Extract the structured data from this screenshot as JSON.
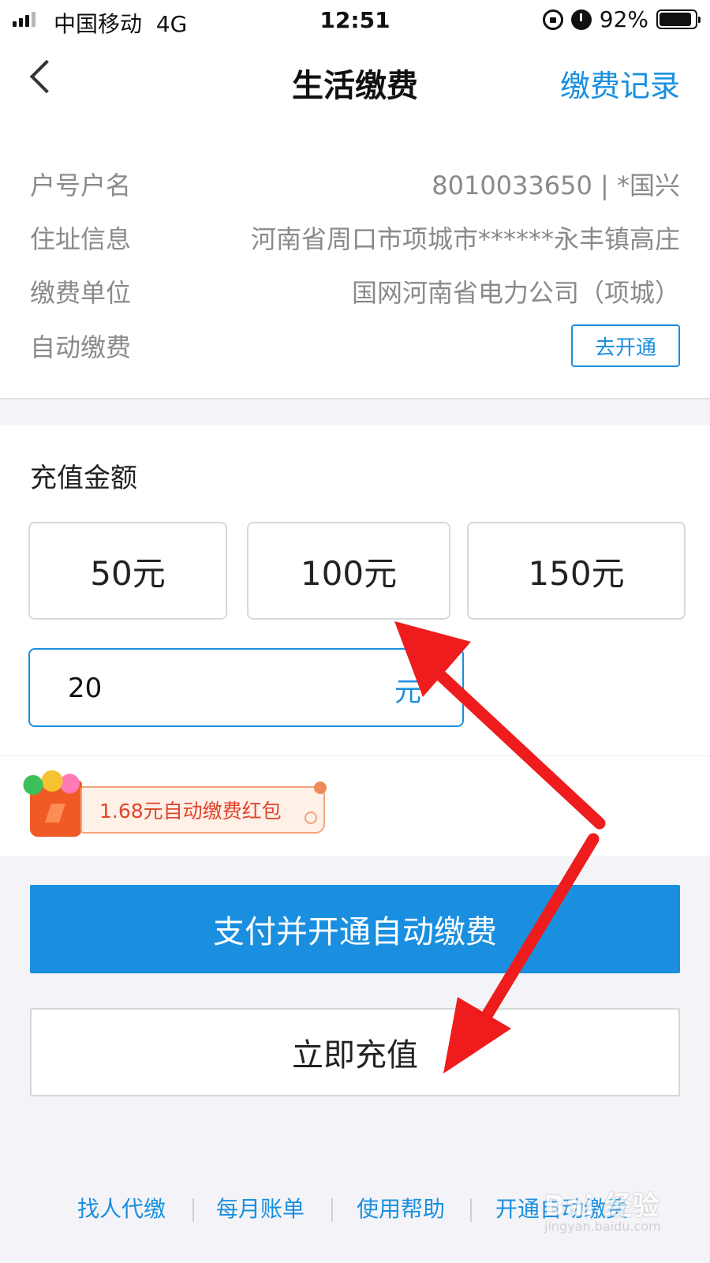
{
  "status_bar": {
    "carrier": "中国移动",
    "network": "4G",
    "time": "12:51",
    "battery": "92%",
    "battery_level": 0.92
  },
  "nav": {
    "title": "生活缴费",
    "record_link": "缴费记录"
  },
  "account": {
    "rows": [
      {
        "label": "户号户名",
        "value": "8010033650 | *国兴"
      },
      {
        "label": "住址信息",
        "value": "河南省周口市项城市******永丰镇高庄"
      },
      {
        "label": "缴费单位",
        "value": "国网河南省电力公司（项城）"
      },
      {
        "label": "自动缴费",
        "button": "去开通"
      }
    ]
  },
  "recharge": {
    "title": "充值金额",
    "options": [
      "50元",
      "100元",
      "150元"
    ],
    "input_value": "20",
    "unit": "元"
  },
  "promo": {
    "text": "1.68元自动缴费红包"
  },
  "buttons": {
    "pay_auto": "支付并开通自动缴费",
    "recharge_now": "立即充值"
  },
  "footer": {
    "links": [
      "找人代缴",
      "每月账单",
      "使用帮助",
      "开通自动缴费"
    ]
  },
  "watermark": {
    "main": "Bai 经验",
    "sub": "jingyan.baidu.com"
  },
  "colors": {
    "accent": "#1a8fe0",
    "arrow": "#ee1c1c",
    "promo_red": "#e0452a"
  }
}
